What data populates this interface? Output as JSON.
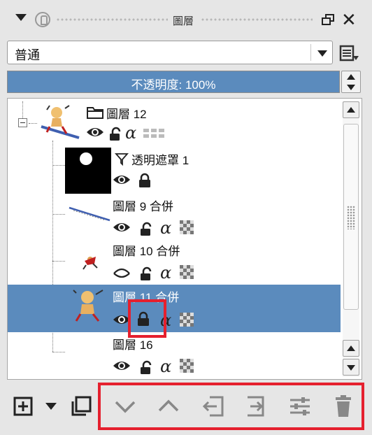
{
  "title_bar": {
    "title": "圖層",
    "collapse_icon": "triangle-down-icon",
    "pin_icon": "pin-icon",
    "float_icon": "float-window-icon",
    "close_label": "✕"
  },
  "blend_mode": {
    "selected": "普通",
    "options_icon": "list-options-icon"
  },
  "opacity": {
    "label": "不透明度:  100%",
    "value_percent": 100
  },
  "layers": [
    {
      "name": "圖層 12",
      "kind": "group",
      "icon": "folder-icon",
      "visible": true,
      "locked": true,
      "alpha_locked": true,
      "inherit_alpha": true,
      "selected": false
    },
    {
      "name": "透明遮罩 1",
      "kind": "transparency-mask",
      "icon": "filter-icon",
      "visible": true,
      "locked": true,
      "selected": false
    },
    {
      "name": "圖層 9 合併",
      "kind": "paint",
      "visible": true,
      "locked": true,
      "alpha_locked": true,
      "selected": false
    },
    {
      "name": "圖層 10 合併",
      "kind": "paint",
      "visible": false,
      "locked": true,
      "alpha_locked": true,
      "selected": false
    },
    {
      "name": "圖層 11 合併",
      "kind": "paint",
      "visible": true,
      "locked": true,
      "alpha_locked": true,
      "selected": true
    },
    {
      "name": "圖層 16",
      "kind": "paint",
      "visible": true,
      "locked": true,
      "alpha_locked": true,
      "selected": false
    }
  ],
  "alpha_glyph": "α",
  "toolbar": {
    "buttons": [
      {
        "name": "add-layer-button",
        "icon": "add-layer-icon"
      },
      {
        "name": "add-layer-menu-button",
        "icon": "chevron-down-icon"
      },
      {
        "name": "duplicate-layer-button",
        "icon": "duplicate-icon"
      },
      {
        "name": "move-layer-down-button",
        "icon": "chevron-down-icon"
      },
      {
        "name": "move-layer-up-button",
        "icon": "chevron-up-icon"
      },
      {
        "name": "move-out-of-group-button",
        "icon": "outdent-icon"
      },
      {
        "name": "move-into-group-button",
        "icon": "indent-icon"
      },
      {
        "name": "layer-properties-button",
        "icon": "sliders-icon"
      },
      {
        "name": "delete-layer-button",
        "icon": "trash-icon"
      }
    ]
  },
  "colors": {
    "selection": "#5b8bbd",
    "highlight": "#e5202e",
    "panel_bg": "#e6e6e6"
  }
}
